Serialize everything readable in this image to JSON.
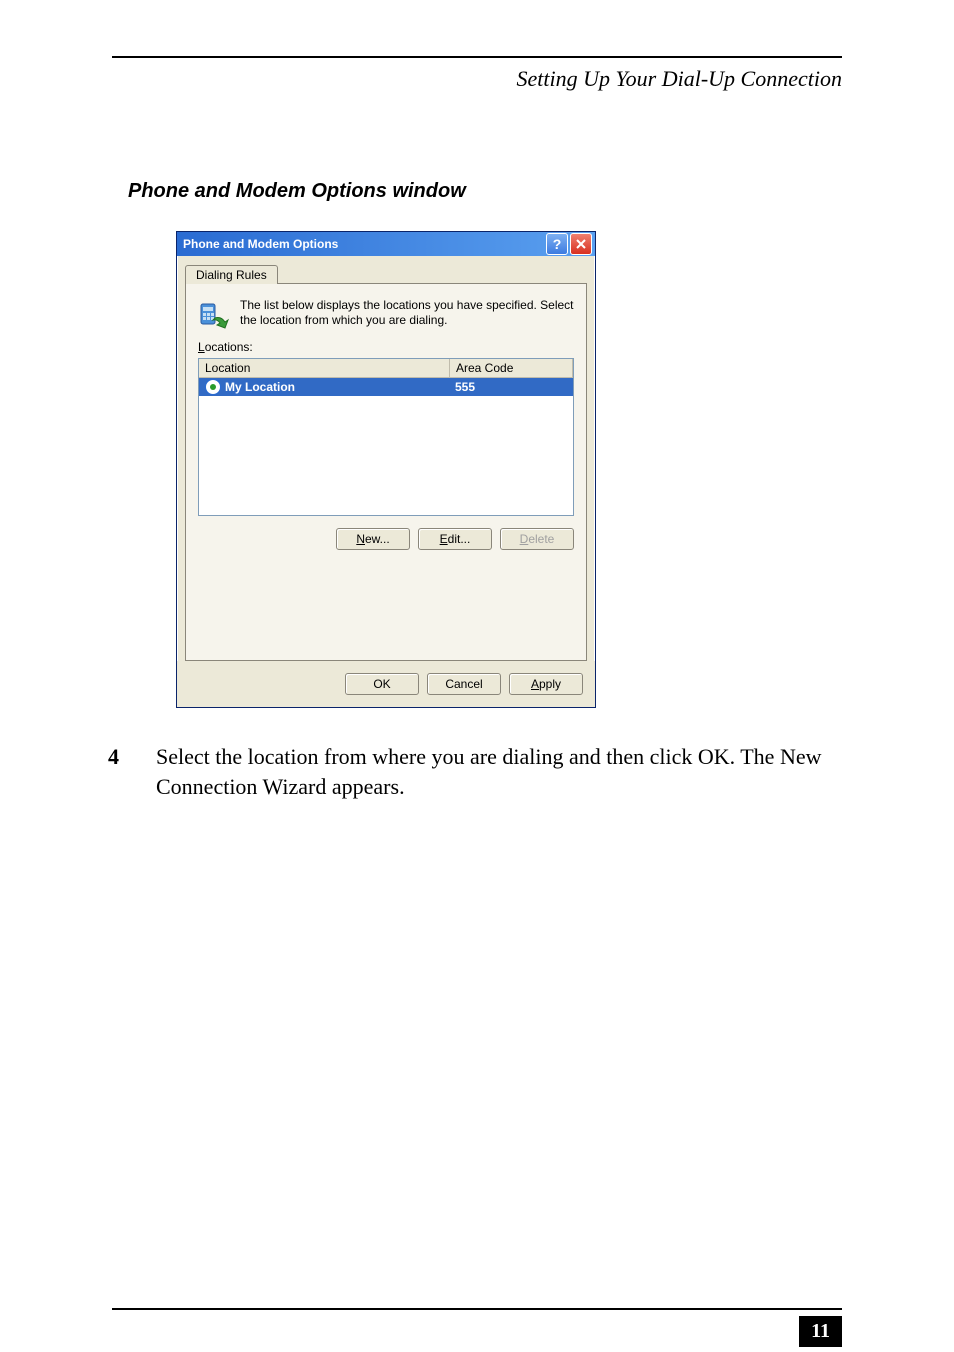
{
  "running_head": "Setting Up Your Dial-Up Connection",
  "section_title": "Phone and Modem Options window",
  "dialog": {
    "title": "Phone and Modem Options",
    "tab_label": "Dialing Rules",
    "intro_text": "The list below displays the locations you have specified. Select the location from which you are dialing.",
    "locations_label_pre": "L",
    "locations_label_post": "ocations:",
    "columns": {
      "location": "Location",
      "area_code": "Area Code"
    },
    "row": {
      "location": "My Location",
      "area_code": "555"
    },
    "buttons": {
      "new_pre": "N",
      "new_post": "ew...",
      "edit_pre": "E",
      "edit_post": "dit...",
      "delete_pre": "D",
      "delete_post": "elete",
      "ok": "OK",
      "cancel": "Cancel",
      "apply_pre": "A",
      "apply_post": "pply"
    }
  },
  "step": {
    "number": "4",
    "text": "Select the location from where you are dialing and then click OK. The New Connection Wizard appears."
  },
  "page_number": "11"
}
